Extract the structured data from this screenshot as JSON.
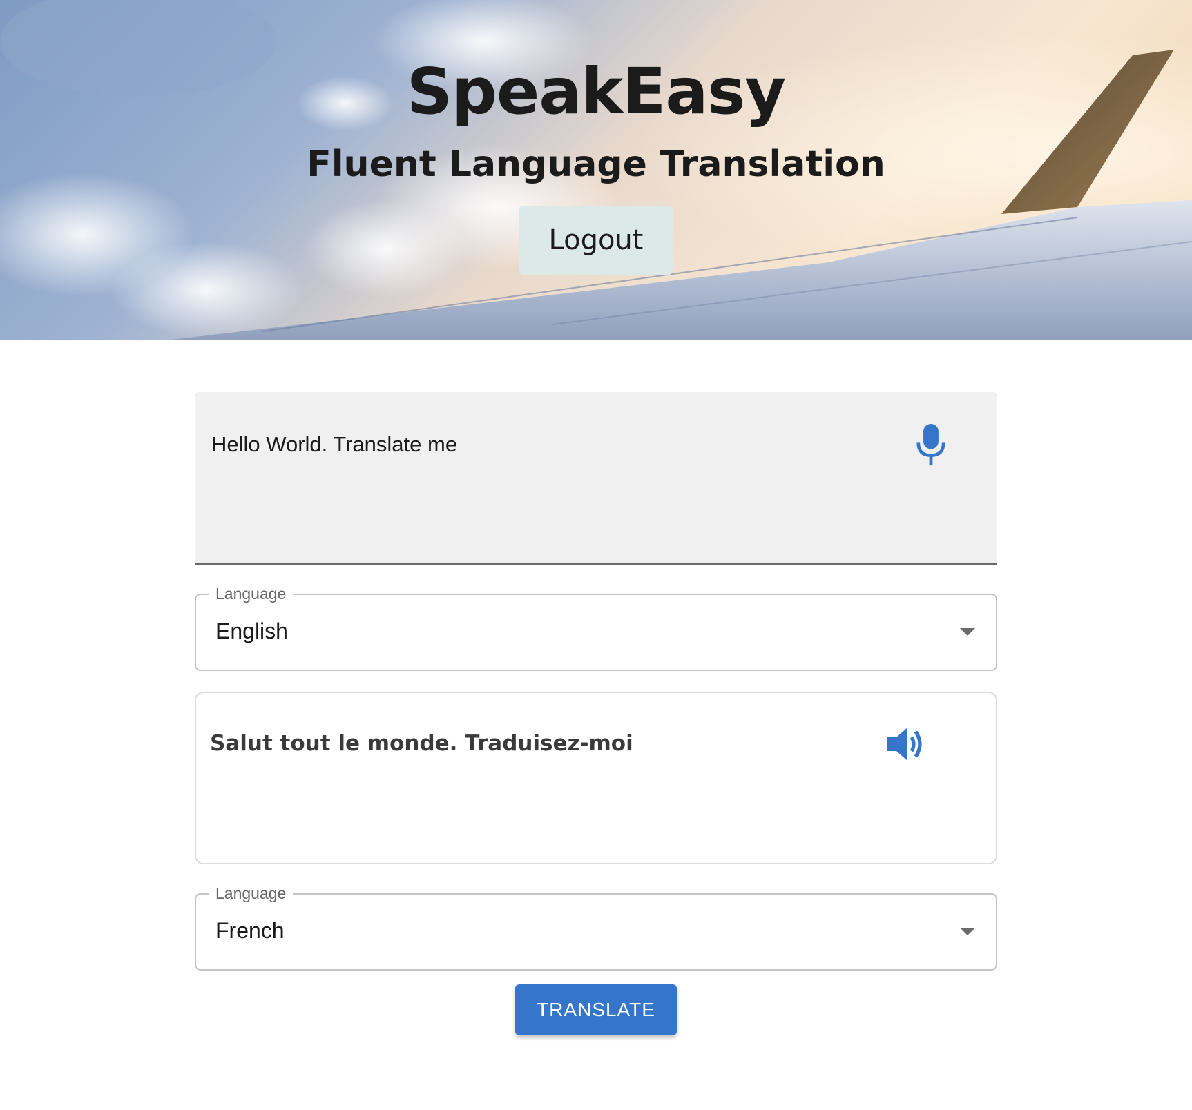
{
  "header": {
    "title": "SpeakEasy",
    "subtitle": "Fluent Language Translation",
    "logout_label": "Logout"
  },
  "source": {
    "text": "Hello World. Translate me",
    "icon": "microphone-icon",
    "language_label": "Language",
    "language_value": "English"
  },
  "target": {
    "text": "Salut tout le monde. Traduisez-moi",
    "icon": "speaker-icon",
    "language_label": "Language",
    "language_value": "French"
  },
  "actions": {
    "translate_label": "TRANSLATE"
  },
  "colors": {
    "accent": "#3576cb",
    "logout_bg": "#dde8e9",
    "input_bg": "#f0f0f0"
  }
}
